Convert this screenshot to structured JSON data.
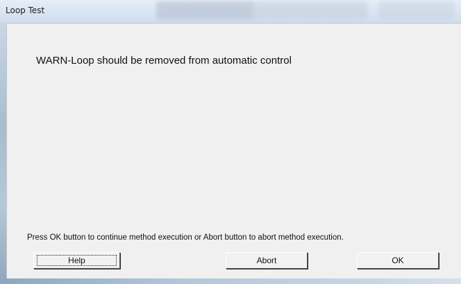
{
  "window": {
    "title": "Loop Test"
  },
  "dialog": {
    "warning_message": "WARN-Loop should be removed from automatic control",
    "instruction_text": "Press OK button to continue method execution or Abort button to abort method execution."
  },
  "buttons": {
    "help_label": "Help",
    "abort_label": "Abort",
    "ok_label": "OK"
  },
  "colors": {
    "client_background": "#f0f0f0",
    "titlebar": "#dbe6f2"
  }
}
